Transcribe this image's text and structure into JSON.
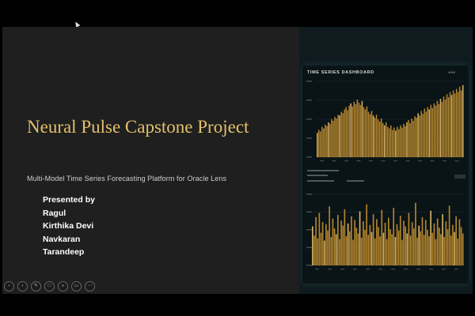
{
  "slide": {
    "title": "Neural Pulse Capstone Project",
    "subtitle": "Multi-Model Time Series Forecasting Platform for Oracle Lens",
    "presented_by_label": "Presented by",
    "presenters": [
      "Ragul",
      "Kirthika Devi",
      "Navkaran",
      "Tarandeep"
    ]
  },
  "dashboard_image": {
    "title": "TIME SERIES DASHBOARD",
    "top_chart": {
      "type": "bar",
      "values": [
        0.32,
        0.36,
        0.34,
        0.4,
        0.38,
        0.43,
        0.41,
        0.46,
        0.44,
        0.5,
        0.48,
        0.53,
        0.51,
        0.56,
        0.55,
        0.6,
        0.58,
        0.63,
        0.66,
        0.62,
        0.68,
        0.71,
        0.67,
        0.73,
        0.7,
        0.76,
        0.72,
        0.69,
        0.74,
        0.66,
        0.63,
        0.67,
        0.6,
        0.57,
        0.61,
        0.55,
        0.52,
        0.56,
        0.5,
        0.47,
        0.51,
        0.45,
        0.42,
        0.46,
        0.4,
        0.38,
        0.42,
        0.36,
        0.39,
        0.35,
        0.4,
        0.37,
        0.42,
        0.39,
        0.44,
        0.41,
        0.46,
        0.49,
        0.45,
        0.51,
        0.48,
        0.54,
        0.52,
        0.58,
        0.55,
        0.61,
        0.57,
        0.64,
        0.6,
        0.66,
        0.63,
        0.69,
        0.65,
        0.71,
        0.68,
        0.74,
        0.7,
        0.77,
        0.73,
        0.8,
        0.76,
        0.83,
        0.79,
        0.86,
        0.82,
        0.88,
        0.84,
        0.9,
        0.86,
        0.93,
        0.88,
        0.95
      ]
    },
    "bottom_chart": {
      "type": "bar",
      "values": [
        0.55,
        0.42,
        0.68,
        0.38,
        0.74,
        0.46,
        0.61,
        0.35,
        0.58,
        0.49,
        0.83,
        0.4,
        0.66,
        0.52,
        0.44,
        0.71,
        0.37,
        0.63,
        0.56,
        0.79,
        0.41,
        0.59,
        0.48,
        0.69,
        0.36,
        0.64,
        0.53,
        0.45,
        0.76,
        0.39,
        0.62,
        0.5,
        0.86,
        0.43,
        0.57,
        0.47,
        0.72,
        0.38,
        0.65,
        0.54,
        0.41,
        0.78,
        0.46,
        0.6,
        0.37,
        0.67,
        0.51,
        0.44,
        0.81,
        0.4,
        0.58,
        0.49,
        0.7,
        0.36,
        0.63,
        0.55,
        0.45,
        0.74,
        0.42,
        0.61,
        0.52,
        0.88,
        0.39,
        0.56,
        0.48,
        0.68,
        0.43,
        0.64,
        0.5,
        0.41,
        0.77,
        0.46,
        0.59,
        0.37,
        0.66,
        0.53,
        0.44,
        0.72,
        0.4,
        0.62,
        0.51,
        0.84,
        0.42,
        0.57,
        0.47,
        0.69,
        0.38,
        0.65,
        0.54,
        0.45
      ]
    },
    "bar_color": "#c9922f",
    "bar_highlight": "#f0c56a"
  },
  "controls": {
    "icons": [
      "prev-icon",
      "next-icon",
      "pen-icon",
      "slides-icon",
      "zoom-icon",
      "subtitles-icon",
      "more-icon"
    ],
    "glyphs": [
      "‹",
      "›",
      "✎",
      "□",
      "⌕",
      "▭",
      "⋯"
    ]
  }
}
